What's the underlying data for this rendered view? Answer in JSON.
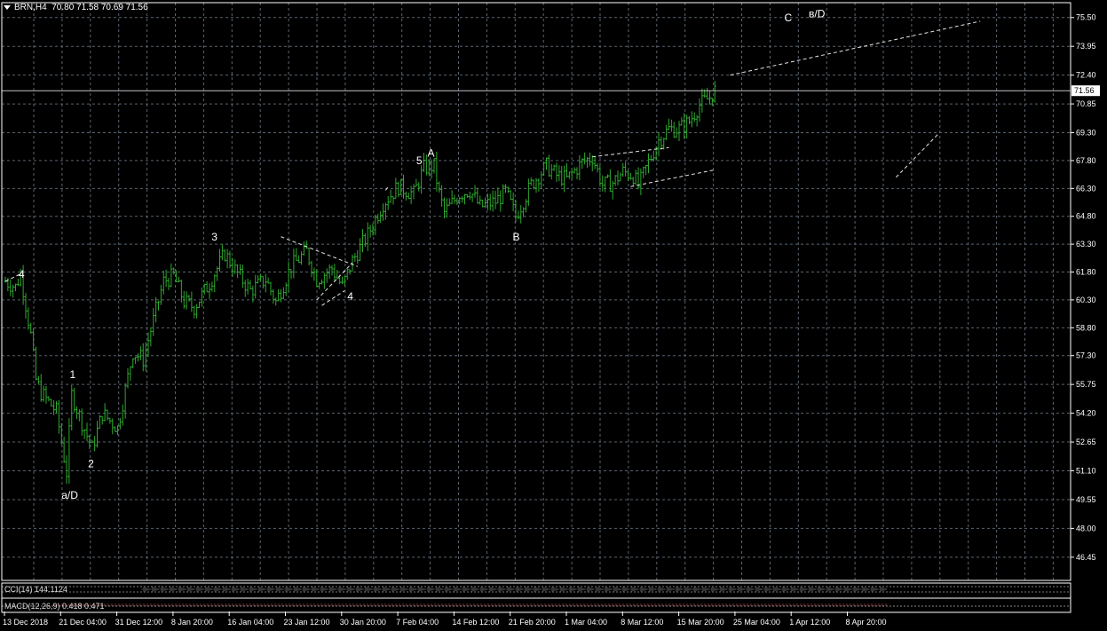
{
  "header": {
    "symbol": "BRN,H4",
    "ohlc": "70.80 71.58 70.69 71.56"
  },
  "price_badge": "71.56",
  "indicators": {
    "cci_label": "CCI(14) 144.1124",
    "macd_label": "MACD(12,26,9) 0.418 0.471"
  },
  "colors": {
    "background": "#000000",
    "candles": "#2ea82e",
    "grid": "#5a6470",
    "text": "#ffffff",
    "frame": "#ffffff"
  },
  "chart_data": {
    "type": "candlestick",
    "ylim": [
      45.2,
      76.3
    ],
    "y_ticks": [
      "75.50",
      "73.95",
      "72.40",
      "70.85",
      "69.30",
      "67.80",
      "66.30",
      "64.80",
      "63.30",
      "61.80",
      "60.30",
      "58.80",
      "57.30",
      "55.75",
      "54.20",
      "52.65",
      "51.10",
      "49.55",
      "48.00",
      "46.45"
    ],
    "x_ticks": [
      "13 Dec 2018",
      "21 Dec 04:00",
      "31 Dec 12:00",
      "8 Jan 20:00",
      "16 Jan 04:00",
      "23 Jan 12:00",
      "30 Jan 20:00",
      "7 Feb 04:00",
      "14 Feb 12:00",
      "21 Feb 20:00",
      "1 Mar 04:00",
      "8 Mar 12:00",
      "15 Mar 20:00",
      "25 Mar 04:00",
      "1 Apr 12:00",
      "8 Apr 20:00"
    ],
    "last_price": 71.56,
    "price_path": [
      {
        "t": 0,
        "p": 61.3
      },
      {
        "t": 2,
        "p": 61.0
      },
      {
        "t": 3,
        "p": 61.7
      },
      {
        "t": 5,
        "p": 58.4
      },
      {
        "t": 6,
        "p": 56.0
      },
      {
        "t": 7,
        "p": 55.3
      },
      {
        "t": 10,
        "p": 54.3
      },
      {
        "t": 12,
        "p": 51.0
      },
      {
        "t": 13,
        "p": 55.2
      },
      {
        "t": 15,
        "p": 53.7
      },
      {
        "t": 17,
        "p": 52.3
      },
      {
        "t": 19,
        "p": 54.2
      },
      {
        "t": 22,
        "p": 53.4
      },
      {
        "t": 25,
        "p": 57.5
      },
      {
        "t": 27,
        "p": 57.1
      },
      {
        "t": 29,
        "p": 59.2
      },
      {
        "t": 31,
        "p": 61.3
      },
      {
        "t": 33,
        "p": 61.6
      },
      {
        "t": 35,
        "p": 60.2
      },
      {
        "t": 37,
        "p": 59.9
      },
      {
        "t": 40,
        "p": 61.2
      },
      {
        "t": 43,
        "p": 62.8
      },
      {
        "t": 45,
        "p": 61.9
      },
      {
        "t": 48,
        "p": 60.8
      },
      {
        "t": 51,
        "p": 61.4
      },
      {
        "t": 53,
        "p": 60.2
      },
      {
        "t": 56,
        "p": 62.1
      },
      {
        "t": 59,
        "p": 62.9
      },
      {
        "t": 61,
        "p": 61.4
      },
      {
        "t": 64,
        "p": 62.0
      },
      {
        "t": 66,
        "p": 61.0
      },
      {
        "t": 68,
        "p": 62.4
      },
      {
        "t": 71,
        "p": 63.8
      },
      {
        "t": 74,
        "p": 65.5
      },
      {
        "t": 77,
        "p": 66.4
      },
      {
        "t": 80,
        "p": 66.0
      },
      {
        "t": 82,
        "p": 67.4
      },
      {
        "t": 84,
        "p": 67.5
      },
      {
        "t": 85,
        "p": 66.0
      },
      {
        "t": 86,
        "p": 65.0
      },
      {
        "t": 89,
        "p": 66.0
      },
      {
        "t": 91,
        "p": 66.2
      },
      {
        "t": 93,
        "p": 65.3
      },
      {
        "t": 96,
        "p": 65.6
      },
      {
        "t": 98,
        "p": 66.1
      },
      {
        "t": 100,
        "p": 64.8
      },
      {
        "t": 103,
        "p": 66.5
      },
      {
        "t": 106,
        "p": 67.5
      },
      {
        "t": 108,
        "p": 67.0
      },
      {
        "t": 110,
        "p": 66.8
      },
      {
        "t": 113,
        "p": 67.7
      },
      {
        "t": 115,
        "p": 68.0
      },
      {
        "t": 117,
        "p": 66.5
      },
      {
        "t": 119,
        "p": 66.6
      },
      {
        "t": 121,
        "p": 67.2
      },
      {
        "t": 123,
        "p": 67.0
      },
      {
        "t": 124,
        "p": 66.4
      },
      {
        "t": 126,
        "p": 67.7
      },
      {
        "t": 128,
        "p": 68.9
      },
      {
        "t": 130,
        "p": 69.5
      },
      {
        "t": 132,
        "p": 69.5
      },
      {
        "t": 134,
        "p": 69.9
      },
      {
        "t": 136,
        "p": 70.8
      },
      {
        "t": 138,
        "p": 71.2
      },
      {
        "t": 139,
        "p": 71.56
      }
    ],
    "wave_labels": [
      {
        "text": "4",
        "t": 2.6,
        "p": 61.5
      },
      {
        "text": "1",
        "t": 12.6,
        "p": 56.1
      },
      {
        "text": "2",
        "t": 16.2,
        "p": 51.3
      },
      {
        "text": "a/D",
        "t": 11.0,
        "p": 49.6
      },
      {
        "text": "3",
        "t": 40.4,
        "p": 63.5
      },
      {
        "text": "4",
        "t": 67.0,
        "p": 60.3
      },
      {
        "text": "5",
        "t": 80.5,
        "p": 67.6
      },
      {
        "text": "A",
        "t": 82.7,
        "p": 68.0
      },
      {
        "text": "B",
        "t": 99.4,
        "p": 63.5
      },
      {
        "text": "C",
        "t": 152.6,
        "p": 75.3
      },
      {
        "text": "в/D",
        "t": 157.4,
        "p": 75.5
      }
    ]
  }
}
